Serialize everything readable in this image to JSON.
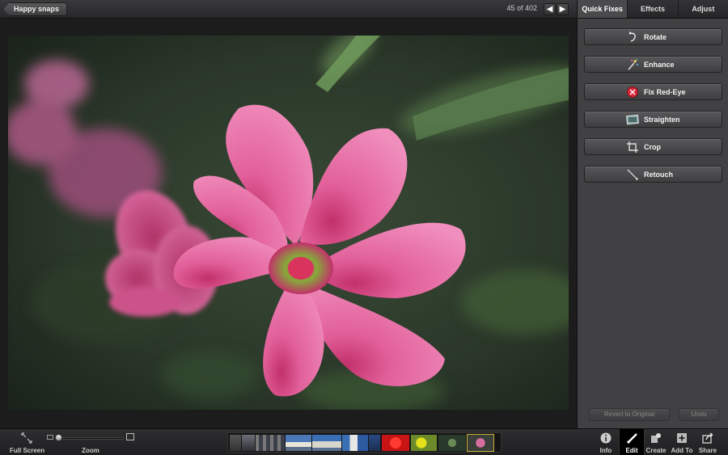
{
  "topbar": {
    "album_button": "Happy snaps",
    "photo_counter": "45 of 402",
    "prev_icon": "left-arrow-icon",
    "next_icon": "right-arrow-icon"
  },
  "panel": {
    "tabs": [
      {
        "label": "Quick Fixes",
        "active": true
      },
      {
        "label": "Effects",
        "active": false
      },
      {
        "label": "Adjust",
        "active": false
      }
    ],
    "tools": [
      {
        "label": "Rotate",
        "icon": "rotate-icon"
      },
      {
        "label": "Enhance",
        "icon": "enhance-wand-icon"
      },
      {
        "label": "Fix Red-Eye",
        "icon": "red-eye-icon"
      },
      {
        "label": "Straighten",
        "icon": "straighten-icon"
      },
      {
        "label": "Crop",
        "icon": "crop-icon"
      },
      {
        "label": "Retouch",
        "icon": "retouch-brush-icon"
      }
    ],
    "revert_label": "Revert to Original",
    "undo_label": "Undo"
  },
  "bottombar": {
    "fullscreen_label": "Full Screen",
    "zoom_label": "Zoom",
    "zoom_level": 0,
    "tools": [
      {
        "label": "Info",
        "icon": "info-icon"
      },
      {
        "label": "Edit",
        "icon": "edit-brush-icon",
        "active": true
      },
      {
        "label": "Create",
        "icon": "create-icon"
      },
      {
        "label": "Add To",
        "icon": "add-to-icon"
      },
      {
        "label": "Share",
        "icon": "share-icon"
      }
    ]
  },
  "colors": {
    "panel_bg": "#414143",
    "photo_bg": "#2c3d2c",
    "flower_pink": "#e2609a",
    "current_thumb_outline": "#c9b13a"
  }
}
